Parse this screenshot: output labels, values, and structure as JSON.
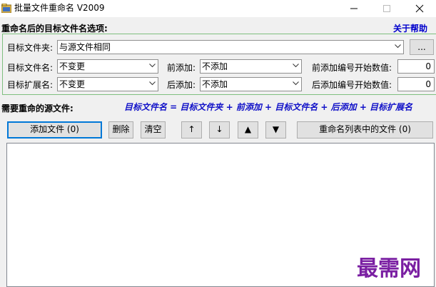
{
  "window": {
    "title": "批量文件重命名 V2009",
    "icon": "folder-app-icon",
    "controls": [
      "minimize-icon",
      "maximize-icon",
      "close-icon"
    ]
  },
  "options": {
    "heading": "重命名后的目标文件名选项:",
    "help_link": "关于帮助",
    "target_folder_label": "目标文件夹:",
    "target_folder_value": "与源文件相同",
    "browse_label": "...",
    "target_name_label": "目标文件名:",
    "target_name_value": "不变更",
    "target_ext_label": "目标扩展名:",
    "target_ext_value": "不变更",
    "prefix_label": "前添加:",
    "prefix_value": "不添加",
    "suffix_label": "后添加:",
    "suffix_value": "不添加",
    "prefix_num_label": "前添加编号开始数值:",
    "prefix_num_value": "0",
    "suffix_num_label": "后添加编号开始数值:",
    "suffix_num_value": "0"
  },
  "source": {
    "heading": "需要重命的源文件:",
    "formula": "目标文件名 = 目标文件夹 +  前添加 + 目标文件名 + 后添加 + 目标扩展名"
  },
  "toolbar": {
    "add_files": "添加文件 (0)",
    "delete": "删除",
    "clear": "清空",
    "move_up": "↑",
    "move_down": "↓",
    "move_top": "▲",
    "move_bottom": "▼",
    "rename": "重命名列表中的文件 (0)"
  },
  "watermark": "最需网",
  "colors": {
    "link_blue": "#0000cc",
    "formula_blue": "#1010c8",
    "group_border": "#7fbf7f",
    "watermark": "#7a1fa2"
  }
}
